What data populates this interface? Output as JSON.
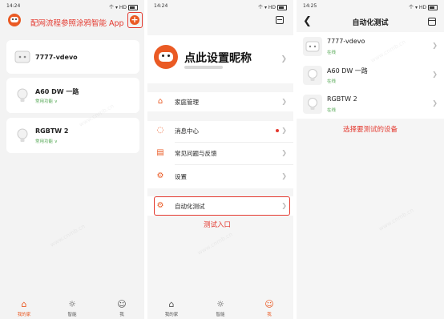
{
  "panel1": {
    "status": {
      "time": "14:24",
      "signal": "个 ▾ HD"
    },
    "annotation": "配网流程参照涂鸦智能 App",
    "add_button": "+",
    "devices": [
      {
        "name": "7777-vdevo",
        "sub": ""
      },
      {
        "name": "A60 DW 一路",
        "sub": "常用功能 ∨"
      },
      {
        "name": "RGBTW 2",
        "sub": "常用功能 ∨"
      }
    ],
    "tabs": [
      {
        "label": "我的家",
        "icon": "home-icon"
      },
      {
        "label": "智能",
        "icon": "sun-icon"
      },
      {
        "label": "我",
        "icon": "user-icon"
      }
    ]
  },
  "panel2": {
    "status": {
      "time": "14:24",
      "signal": "个 ▾ HD"
    },
    "nickname": "点此设置昵称",
    "menu": [
      {
        "label": "家庭管理",
        "icon": "home-icon"
      },
      {
        "label": "消息中心",
        "icon": "message-icon"
      },
      {
        "label": "常见问题与反馈",
        "icon": "book-icon"
      },
      {
        "label": "设置",
        "icon": "settings-icon"
      },
      {
        "label": "自动化测试",
        "icon": "robot-icon"
      }
    ],
    "annotation": "测试入口",
    "tabs": [
      {
        "label": "我的家",
        "icon": "home-icon"
      },
      {
        "label": "智能",
        "icon": "sun-icon"
      },
      {
        "label": "我",
        "icon": "user-icon"
      }
    ]
  },
  "panel3": {
    "status": {
      "time": "14:25",
      "signal": "个 ▾ HD"
    },
    "title": "自动化测试",
    "devices": [
      {
        "name": "7777-vdevo",
        "status": "在线"
      },
      {
        "name": "A60 DW 一路",
        "status": "在线"
      },
      {
        "name": "RGBTW 2",
        "status": "在线"
      }
    ],
    "annotation": "选择要测试的设备"
  },
  "colors": {
    "accent": "#ea5a24",
    "annotation": "#e4392f",
    "online": "#55a855"
  }
}
